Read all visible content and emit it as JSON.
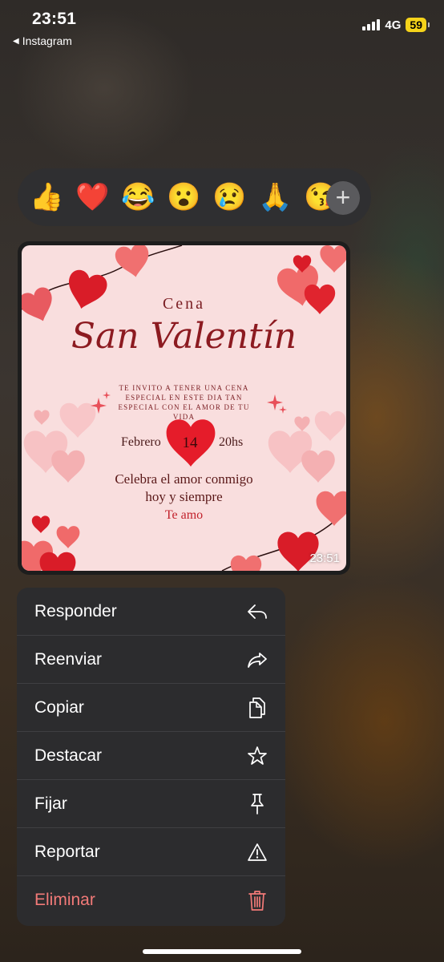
{
  "status_bar": {
    "time": "23:51",
    "back_app": "Instagram",
    "network": "4G",
    "battery": "59"
  },
  "reactions": {
    "emojis": [
      "👍",
      "❤️",
      "😂",
      "😮",
      "😢",
      "🙏",
      "😘"
    ],
    "add_label": "+"
  },
  "message": {
    "card": {
      "heading": "Cena",
      "title": "San Valentín",
      "invite_text": "TE INVITO A TENER UNA CENA ESPECIAL EN ESTE DIA TAN ESPECIAL CON EL AMOR DE TU VIDA",
      "month": "Febrero",
      "day": "14",
      "hour": "20hs",
      "celebrate_line1": "Celebra el amor conmigo",
      "celebrate_line2": "hoy y siempre",
      "closing": "Te amo"
    },
    "timestamp": "23:51"
  },
  "menu": {
    "items": [
      {
        "label": "Responder",
        "icon": "reply-icon"
      },
      {
        "label": "Reenviar",
        "icon": "forward-icon"
      },
      {
        "label": "Copiar",
        "icon": "copy-icon"
      },
      {
        "label": "Destacar",
        "icon": "star-icon"
      },
      {
        "label": "Fijar",
        "icon": "pin-icon"
      },
      {
        "label": "Reportar",
        "icon": "warning-icon"
      },
      {
        "label": "Eliminar",
        "icon": "trash-icon",
        "color": "#f27a78"
      }
    ]
  }
}
